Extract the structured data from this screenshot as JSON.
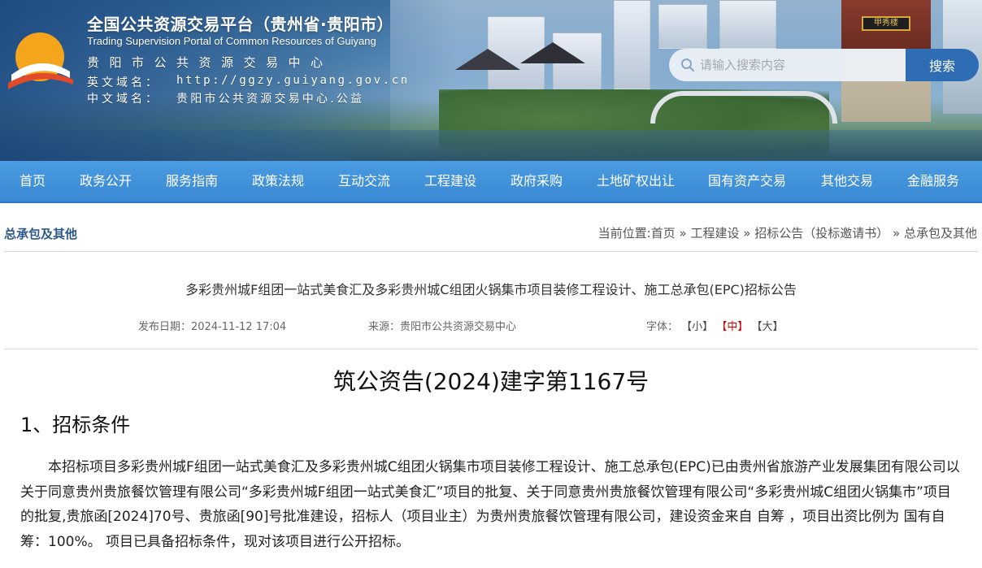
{
  "header": {
    "title": "全国公共资源交易平台（贵州省·贵阳市）",
    "subtitle": "Trading Supervision Portal of Common Resources of Guiyang",
    "org": "贵阳市公共资源交易中心",
    "en_domain_label": "英文域名：",
    "en_domain_value": "http://ggzy.guiyang.gov.cn",
    "cn_domain_label": "中文域名：",
    "cn_domain_value": "贵阳市公共资源交易中心.公益",
    "pavilion_sign": "甲秀楼"
  },
  "search": {
    "placeholder": "请输入搜索内容",
    "button": "搜索"
  },
  "nav": {
    "items": [
      {
        "label": "首页"
      },
      {
        "label": "政务公开"
      },
      {
        "label": "服务指南"
      },
      {
        "label": "政策法规"
      },
      {
        "label": "互动交流"
      },
      {
        "label": "工程建设"
      },
      {
        "label": "政府采购"
      },
      {
        "label": "土地矿权出让"
      },
      {
        "label": "国有资产交易"
      },
      {
        "label": "其他交易"
      },
      {
        "label": "金融服务"
      }
    ]
  },
  "section": {
    "title": "总承包及其他"
  },
  "breadcrumb": {
    "prefix": "当前位置:",
    "items": [
      "首页",
      "工程建设",
      "招标公告（投标邀请书）",
      "总承包及其他"
    ],
    "separator": "»"
  },
  "article": {
    "title": "多彩贵州城F组团一站式美食汇及多彩贵州城C组团火锅集市项目装修工程设计、施工总承包(EPC)招标公告",
    "publish_label": "发布日期：",
    "publish_date": "2024-11-12 17:04",
    "source_label": "来源：",
    "source": "贵阳市公共资源交易中心",
    "font_label": "字体：",
    "font_small": "【小】",
    "font_medium": "【中】",
    "font_large": "【大】",
    "doc_number": "筑公资告(2024)建字第1167号",
    "heading_1": "1、招标条件",
    "paragraph_1": "本招标项目多彩贵州城F组团一站式美食汇及多彩贵州城C组团火锅集市项目装修工程设计、施工总承包(EPC)已由贵州省旅游产业发展集团有限公司以 关于同意贵州贵旅餐饮管理有限公司“多彩贵州城F组团一站式美食汇”项目的批复、关于同意贵州贵旅餐饮管理有限公司“多彩贵州城C组团火锅集市”项目的批复,贵旅函[2024]70号、贵旅函[90]号批准建设，招标人（项目业主）为贵州贵旅餐饮管理有限公司，建设资金来自 自筹 ，项目出资比例为 国有自筹：100%。 项目已具备招标条件，现对该项目进行公开招标。"
  },
  "colors": {
    "nav_bg": "#3a89d4",
    "search_button": "#2e6db3",
    "section_title": "#2b5a8a",
    "font_active": "#d40000"
  }
}
